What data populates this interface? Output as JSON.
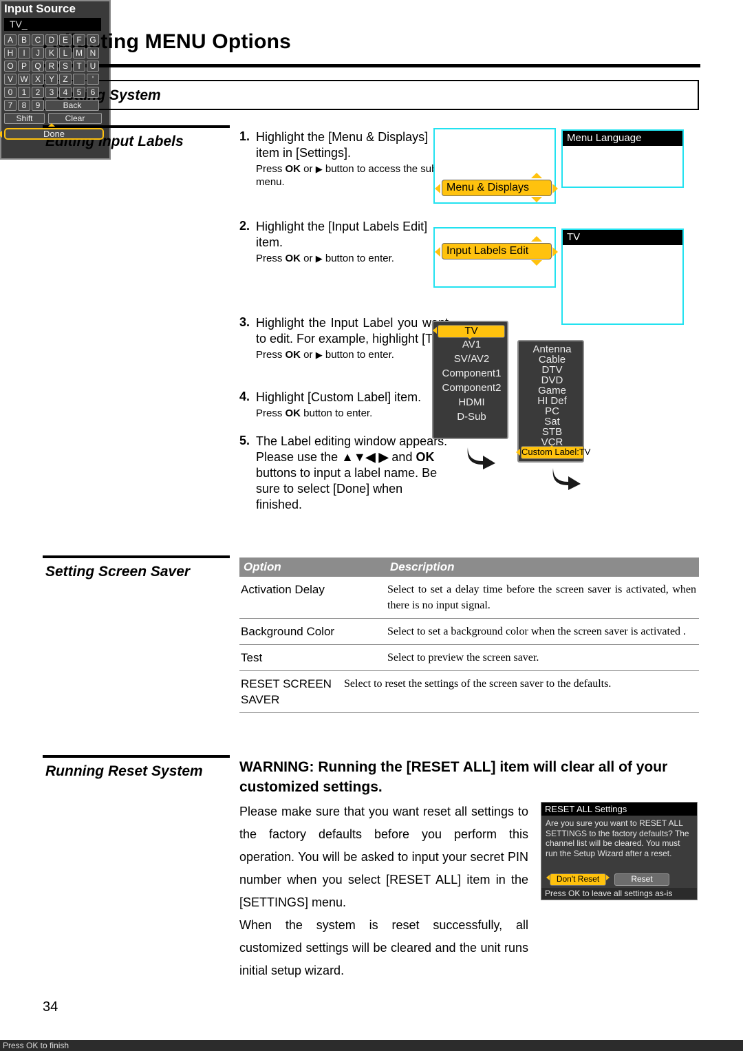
{
  "document": {
    "page_title": "Adjusting MENU Options",
    "section_title": "Setting System",
    "page_number": "34"
  },
  "sections": {
    "editing_input_labels": {
      "heading": "Editing Input Labels",
      "steps": [
        {
          "num": "1.",
          "main": "Highlight the [Menu & Displays] item in [Settings].",
          "sub_pre": "Press ",
          "sub_ok": "OK",
          "sub_or": " or ",
          "sub_arrow": "▶",
          "sub_post": " button to access the sub-menu."
        },
        {
          "num": "2.",
          "main": "Highlight the [Input Labels Edit] item.",
          "sub_pre": "Press ",
          "sub_ok": "OK",
          "sub_or": " or ",
          "sub_arrow": "▶",
          "sub_post": " button to enter."
        },
        {
          "num": "3.",
          "main": "Highlight the Input Label you want to edit. For example, highlight [TV].",
          "sub_pre": "Press ",
          "sub_ok": "OK",
          "sub_or": " or ",
          "sub_arrow": "▶",
          "sub_post": " button to enter."
        },
        {
          "num": "4.",
          "main": "Highlight [Custom Label] item.",
          "sub_pre": "Press ",
          "sub_ok": "OK",
          "sub_or": "",
          "sub_arrow": "",
          "sub_post": " button to enter."
        },
        {
          "num": "5.",
          "main_a": "The Label editing window appears. Please use the ",
          "main_arrows": "▲▼◀ ▶",
          "main_b": " and ",
          "main_ok": "OK",
          "main_c": " buttons to input a label name. Be sure to select [Done] when finished."
        }
      ]
    },
    "screen_saver": {
      "heading": "Setting Screen Saver",
      "table": {
        "headers": [
          "Option",
          "Description"
        ],
        "rows": [
          {
            "option": "Activation Delay",
            "description": "Select to set a delay time before the screen saver is activated, when there is no input signal."
          },
          {
            "option": "Background Color",
            "description": "Select to set a background color when the screen saver is activated ."
          },
          {
            "option": "Test",
            "description": "Select to preview the screen saver."
          },
          {
            "option": "RESET SCREEN SAVER",
            "description": "Select to reset the settings of the screen saver to the defaults."
          }
        ]
      }
    },
    "reset_system": {
      "heading": "Running Reset System",
      "warning_a": "WARNING: Running ",
      "warning_b": "the [RESET ALL] item will clear all of your customized settings.",
      "paragraphs": [
        "Please make sure that you want reset all settings to the factory defaults before you perform this operation. You will be asked to input your secret PIN number when you select [RESET ALL] item in the [SETTINGS] menu.",
        "When the system is reset successfully, all customized settings will be cleared and the unit runs initial setup wizard."
      ]
    }
  },
  "osd": {
    "menu_displays_screen": {
      "highlight": "Menu & Displays"
    },
    "menu_language_screen": {
      "title": "Menu Language"
    },
    "input_labels_screen": {
      "highlight": "Input Labels Edit"
    },
    "tv_screen": {
      "title": "TV"
    },
    "input_list": {
      "selected": "TV",
      "items": [
        "AV1",
        "SV/AV2",
        "Component1",
        "Component2",
        "HDMI",
        "D-Sub"
      ]
    },
    "sub_list": {
      "items": [
        "Antenna",
        "Cable",
        "DTV",
        "DVD",
        "Game",
        "HI Def",
        "PC",
        "Sat",
        "STB",
        "VCR"
      ],
      "custom_label": "Custom Label:TV"
    },
    "keyboard": {
      "title": "Input Source",
      "field_value": "TV_",
      "rows": [
        [
          "A",
          "B",
          "C",
          "D",
          "E",
          "F",
          "G"
        ],
        [
          "H",
          "I",
          "J",
          "K",
          "L",
          "M",
          "N"
        ],
        [
          "O",
          "P",
          "Q",
          "R",
          "S",
          "T",
          "U"
        ],
        [
          "V",
          "W",
          "X",
          "Y",
          "Z",
          "",
          "'"
        ],
        [
          "0",
          "1",
          "2",
          "3",
          "4",
          "5",
          "6"
        ]
      ],
      "row6": [
        "7",
        "8",
        "9"
      ],
      "back_label": "Back",
      "shift_label": "Shift",
      "clear_label": "Clear",
      "done_label": "Done",
      "status": "Press OK to finish"
    },
    "reset_dialog": {
      "title": "RESET ALL Settings",
      "message": "Are you sure you want to RESET ALL SETTINGS to the factory defaults? The channel list will be cleared. You must run the Setup Wizard after a reset.",
      "dont_reset_label": "Don't Reset",
      "reset_label": "Reset",
      "footer": "Press OK to leave all settings as-is"
    }
  },
  "colors": {
    "highlight_yellow": "#ffc20e",
    "osd_cyan": "#22e2f0",
    "table_header_gray": "#8c8c8c",
    "panel_dark": "#3a3a3a"
  }
}
